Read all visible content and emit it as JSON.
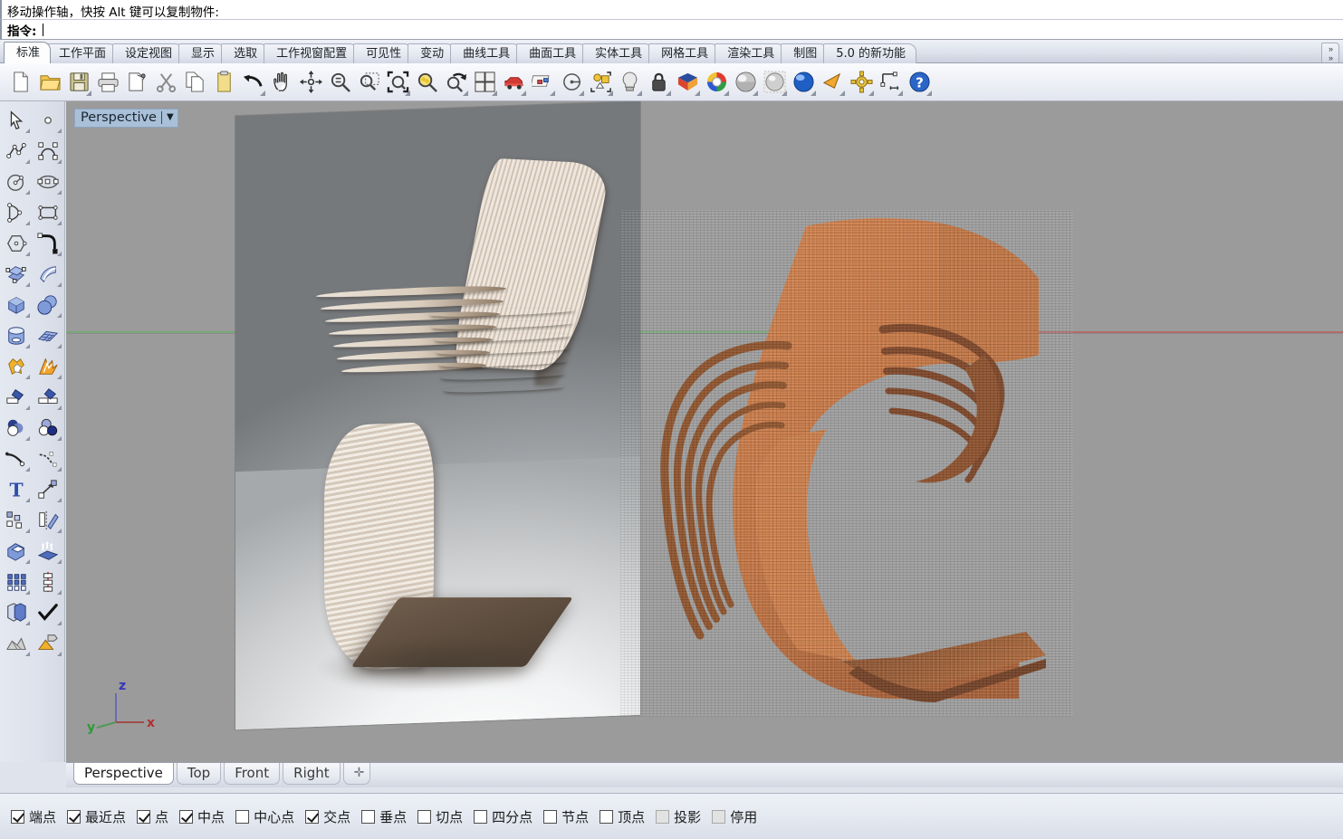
{
  "command_area": {
    "history_line": "移动操作轴，快按 Alt 键可以复制物件:",
    "prompt_label": "指令:",
    "prompt_value": ""
  },
  "tabbar": {
    "tabs": [
      {
        "label": "标准",
        "active": true
      },
      {
        "label": "工作平面",
        "active": false
      },
      {
        "label": "设定视图",
        "active": false
      },
      {
        "label": "显示",
        "active": false
      },
      {
        "label": "选取",
        "active": false
      },
      {
        "label": "工作视窗配置",
        "active": false
      },
      {
        "label": "可见性",
        "active": false
      },
      {
        "label": "变动",
        "active": false
      },
      {
        "label": "曲线工具",
        "active": false
      },
      {
        "label": "曲面工具",
        "active": false
      },
      {
        "label": "实体工具",
        "active": false
      },
      {
        "label": "网格工具",
        "active": false
      },
      {
        "label": "渲染工具",
        "active": false
      },
      {
        "label": "制图",
        "active": false
      },
      {
        "label": "5.0 的新功能",
        "active": false
      }
    ],
    "overflow_label": "»»"
  },
  "toolbar_top": {
    "buttons": [
      {
        "icon": "new-file-icon",
        "flyout": false
      },
      {
        "icon": "open-folder-icon",
        "flyout": false
      },
      {
        "icon": "save-icon",
        "flyout": true
      },
      {
        "icon": "print-icon",
        "flyout": false
      },
      {
        "icon": "copy-to-clipboard-icon",
        "flyout": false
      },
      {
        "icon": "cut-scissors-icon",
        "flyout": false
      },
      {
        "icon": "copy-pages-icon",
        "flyout": false
      },
      {
        "icon": "paste-clipboard-icon",
        "flyout": false
      },
      {
        "icon": "undo-arrow-icon",
        "flyout": true
      },
      {
        "icon": "pan-hand-icon",
        "flyout": false
      },
      {
        "icon": "rotate-view-icon",
        "flyout": false
      },
      {
        "icon": "zoom-in-out-icon",
        "flyout": false
      },
      {
        "icon": "zoom-window-icon",
        "flyout": false
      },
      {
        "icon": "zoom-extents-icon",
        "flyout": true
      },
      {
        "icon": "zoom-selected-icon",
        "flyout": false
      },
      {
        "icon": "zoom-previous-icon",
        "flyout": true
      },
      {
        "icon": "viewport-layout-icon",
        "flyout": true
      },
      {
        "icon": "render-car-icon",
        "flyout": true
      },
      {
        "icon": "layers-icon",
        "flyout": true
      },
      {
        "icon": "cplane-icon",
        "flyout": true
      },
      {
        "icon": "select-objects-icon",
        "flyout": true
      },
      {
        "icon": "light-bulb-icon",
        "flyout": true
      },
      {
        "icon": "lock-icon",
        "flyout": true
      },
      {
        "icon": "material-swatch-icon",
        "flyout": true
      },
      {
        "icon": "color-wheel-icon",
        "flyout": true
      },
      {
        "icon": "shaded-sphere-icon",
        "flyout": true
      },
      {
        "icon": "ghosted-sphere-icon",
        "flyout": true
      },
      {
        "icon": "rendered-sphere-icon",
        "flyout": true
      },
      {
        "icon": "flat-shade-icon",
        "flyout": true
      },
      {
        "icon": "options-gear-icon",
        "flyout": true
      },
      {
        "icon": "dimension-icon",
        "flyout": true
      },
      {
        "icon": "help-icon",
        "flyout": true
      }
    ]
  },
  "toolbar_left": {
    "rows": [
      [
        {
          "icon": "select-arrow-icon"
        },
        {
          "icon": "point-object-icon"
        }
      ],
      [
        {
          "icon": "polyline-icon"
        },
        {
          "icon": "control-point-curve-icon"
        }
      ],
      [
        {
          "icon": "circle-icon"
        },
        {
          "icon": "ellipse-icon"
        }
      ],
      [
        {
          "icon": "arc-icon"
        },
        {
          "icon": "rectangle-icon"
        }
      ],
      [
        {
          "icon": "polygon-icon"
        },
        {
          "icon": "fillet-curve-icon"
        }
      ],
      [
        {
          "icon": "surface-from-points-icon"
        },
        {
          "icon": "extrude-surface-icon"
        }
      ],
      [
        {
          "icon": "box-solid-icon"
        },
        {
          "icon": "sphere-solid-icon"
        }
      ],
      [
        {
          "icon": "cylinder-solid-icon"
        },
        {
          "icon": "mesh-plane-icon"
        }
      ],
      [
        {
          "icon": "boolean-tools-icon"
        },
        {
          "icon": "explode-icon"
        }
      ],
      [
        {
          "icon": "trim-icon"
        },
        {
          "icon": "split-icon"
        }
      ],
      [
        {
          "icon": "boolean-union-icon"
        },
        {
          "icon": "boolean-difference-icon"
        }
      ],
      [
        {
          "icon": "offset-curve-icon"
        },
        {
          "icon": "blend-curve-icon"
        }
      ],
      [
        {
          "icon": "text-object-icon"
        },
        {
          "icon": "move-icon"
        }
      ],
      [
        {
          "icon": "array-icon"
        },
        {
          "icon": "mirror-icon"
        }
      ],
      [
        {
          "icon": "cap-solid-icon"
        },
        {
          "icon": "extrude-planar-icon"
        }
      ],
      [
        {
          "icon": "rectangular-array-icon"
        },
        {
          "icon": "polar-array-icon"
        }
      ],
      [
        {
          "icon": "copy-object-icon"
        },
        {
          "icon": "check-mark-icon"
        }
      ],
      [
        {
          "icon": "mesh-from-surface-icon"
        },
        {
          "icon": "render-preview-icon"
        }
      ]
    ]
  },
  "viewport": {
    "label": "Perspective",
    "dropdown_glyph": "▼",
    "background_color": "#9b9b9b",
    "axis_gizmo": {
      "x": "x",
      "y": "y",
      "z": "z",
      "x_color": "#cc2222",
      "y_color": "#22aa33",
      "z_color": "#3333cc"
    },
    "horizon_grey_color": "#8c8c8c",
    "horizon_green_color": "#77a878",
    "horizon_red_color": "#b06b6b",
    "content": {
      "reference_image_plane": "wooden ribbon lounge chair photograph",
      "model": "orange shaded cantilever ribbon chair"
    }
  },
  "viewport_tabs": {
    "tabs": [
      {
        "label": "Perspective",
        "active": true
      },
      {
        "label": "Top",
        "active": false
      },
      {
        "label": "Front",
        "active": false
      },
      {
        "label": "Right",
        "active": false
      }
    ],
    "add_label": "✛"
  },
  "osnap_bar": {
    "items": [
      {
        "label": "端点",
        "checked": true,
        "disabled": false
      },
      {
        "label": "最近点",
        "checked": true,
        "disabled": false
      },
      {
        "label": "点",
        "checked": true,
        "disabled": false
      },
      {
        "label": "中点",
        "checked": true,
        "disabled": false
      },
      {
        "label": "中心点",
        "checked": false,
        "disabled": false
      },
      {
        "label": "交点",
        "checked": true,
        "disabled": false
      },
      {
        "label": "垂点",
        "checked": false,
        "disabled": false
      },
      {
        "label": "切点",
        "checked": false,
        "disabled": false
      },
      {
        "label": "四分点",
        "checked": false,
        "disabled": false
      },
      {
        "label": "节点",
        "checked": false,
        "disabled": false
      },
      {
        "label": "顶点",
        "checked": false,
        "disabled": false
      },
      {
        "label": "投影",
        "checked": false,
        "disabled": true
      },
      {
        "label": "停用",
        "checked": false,
        "disabled": true
      }
    ]
  }
}
